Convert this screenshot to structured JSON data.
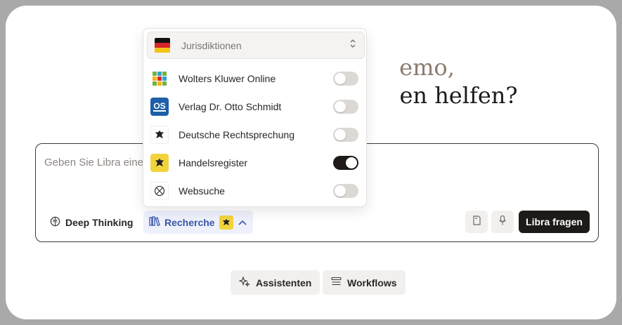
{
  "greeting": {
    "line1": "emo,",
    "line2": "en helfen?"
  },
  "composer": {
    "placeholder": "Geben Sie Libra eine",
    "deep_thinking_label": "Deep Thinking",
    "recherche_label": "Recherche",
    "submit_label": "Libra fragen"
  },
  "dropdown": {
    "jurisdiction_label": "Jurisdiktionen",
    "sources": [
      {
        "label": "Wolters Kluwer Online",
        "enabled": false,
        "icon": "wolters-kluwer-logo"
      },
      {
        "label": "Verlag Dr. Otto Schmidt",
        "enabled": false,
        "icon": "otto-schmidt-logo",
        "logo_text": "OS"
      },
      {
        "label": "Deutsche Rechtsprechung",
        "enabled": false,
        "icon": "federal-eagle"
      },
      {
        "label": "Handelsregister",
        "enabled": true,
        "icon": "federal-eagle-yellow"
      },
      {
        "label": "Websuche",
        "enabled": false,
        "icon": "globe-icon"
      }
    ]
  },
  "bottom": {
    "assistants_label": "Assistenten",
    "workflows_label": "Workflows"
  },
  "colors": {
    "accent_dark": "#1d1a17",
    "recherche_blue": "#3a57a7",
    "greeting_muted": "#8b7b6e"
  }
}
